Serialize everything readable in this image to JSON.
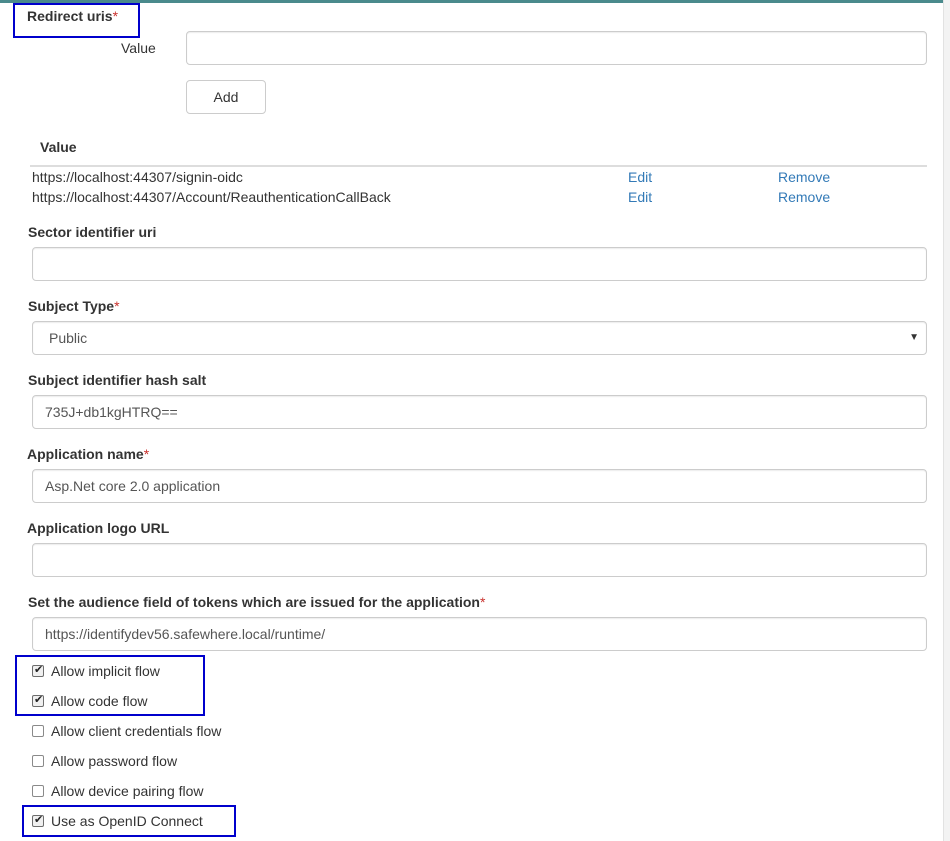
{
  "redirect_uris": {
    "label": "Redirect uris",
    "required_mark": "*",
    "value_label": "Value",
    "value_input": "",
    "add_button": "Add",
    "table": {
      "header": "Value",
      "rows": [
        {
          "value": "https://localhost:44307/signin-oidc",
          "edit": "Edit",
          "remove": "Remove"
        },
        {
          "value": "https://localhost:44307/Account/ReauthenticationCallBack",
          "edit": "Edit",
          "remove": "Remove"
        }
      ]
    }
  },
  "sector_identifier": {
    "label": "Sector identifier uri",
    "value": ""
  },
  "subject_type": {
    "label": "Subject Type",
    "required_mark": "*",
    "selected": "Public",
    "caret": "▼"
  },
  "hash_salt": {
    "label": "Subject identifier hash salt",
    "value": "735J+db1kgHTRQ=="
  },
  "application_name": {
    "label": "Application name",
    "required_mark": "*",
    "value": "Asp.Net core 2.0 application"
  },
  "logo_url": {
    "label": "Application logo URL",
    "value": ""
  },
  "audience": {
    "label": "Set the audience field of tokens which are issued for the application",
    "required_mark": "*",
    "value": "https://identifydev56.safewhere.local/runtime/"
  },
  "flows": [
    {
      "label": "Allow implicit flow",
      "checked": true
    },
    {
      "label": "Allow code flow",
      "checked": true
    },
    {
      "label": "Allow client credentials flow",
      "checked": false
    },
    {
      "label": "Allow password flow",
      "checked": false
    },
    {
      "label": "Allow device pairing flow",
      "checked": false
    },
    {
      "label": "Use as OpenID Connect",
      "checked": true
    }
  ],
  "tick_glyph": "✔",
  "colors": {
    "highlight": "#0000cc",
    "link": "#337ab7",
    "required": "#c9302c"
  }
}
